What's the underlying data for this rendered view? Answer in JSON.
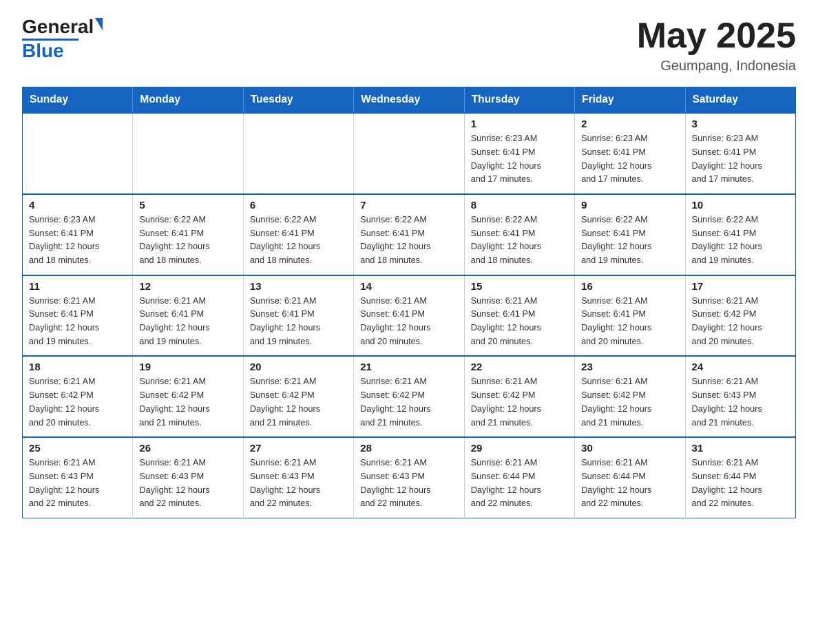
{
  "header": {
    "logo_general": "General",
    "logo_blue": "Blue",
    "title": "May 2025",
    "subtitle": "Geumpang, Indonesia"
  },
  "weekdays": [
    "Sunday",
    "Monday",
    "Tuesday",
    "Wednesday",
    "Thursday",
    "Friday",
    "Saturday"
  ],
  "weeks": [
    [
      {
        "day": "",
        "info": ""
      },
      {
        "day": "",
        "info": ""
      },
      {
        "day": "",
        "info": ""
      },
      {
        "day": "",
        "info": ""
      },
      {
        "day": "1",
        "info": "Sunrise: 6:23 AM\nSunset: 6:41 PM\nDaylight: 12 hours\nand 17 minutes."
      },
      {
        "day": "2",
        "info": "Sunrise: 6:23 AM\nSunset: 6:41 PM\nDaylight: 12 hours\nand 17 minutes."
      },
      {
        "day": "3",
        "info": "Sunrise: 6:23 AM\nSunset: 6:41 PM\nDaylight: 12 hours\nand 17 minutes."
      }
    ],
    [
      {
        "day": "4",
        "info": "Sunrise: 6:23 AM\nSunset: 6:41 PM\nDaylight: 12 hours\nand 18 minutes."
      },
      {
        "day": "5",
        "info": "Sunrise: 6:22 AM\nSunset: 6:41 PM\nDaylight: 12 hours\nand 18 minutes."
      },
      {
        "day": "6",
        "info": "Sunrise: 6:22 AM\nSunset: 6:41 PM\nDaylight: 12 hours\nand 18 minutes."
      },
      {
        "day": "7",
        "info": "Sunrise: 6:22 AM\nSunset: 6:41 PM\nDaylight: 12 hours\nand 18 minutes."
      },
      {
        "day": "8",
        "info": "Sunrise: 6:22 AM\nSunset: 6:41 PM\nDaylight: 12 hours\nand 18 minutes."
      },
      {
        "day": "9",
        "info": "Sunrise: 6:22 AM\nSunset: 6:41 PM\nDaylight: 12 hours\nand 19 minutes."
      },
      {
        "day": "10",
        "info": "Sunrise: 6:22 AM\nSunset: 6:41 PM\nDaylight: 12 hours\nand 19 minutes."
      }
    ],
    [
      {
        "day": "11",
        "info": "Sunrise: 6:21 AM\nSunset: 6:41 PM\nDaylight: 12 hours\nand 19 minutes."
      },
      {
        "day": "12",
        "info": "Sunrise: 6:21 AM\nSunset: 6:41 PM\nDaylight: 12 hours\nand 19 minutes."
      },
      {
        "day": "13",
        "info": "Sunrise: 6:21 AM\nSunset: 6:41 PM\nDaylight: 12 hours\nand 19 minutes."
      },
      {
        "day": "14",
        "info": "Sunrise: 6:21 AM\nSunset: 6:41 PM\nDaylight: 12 hours\nand 20 minutes."
      },
      {
        "day": "15",
        "info": "Sunrise: 6:21 AM\nSunset: 6:41 PM\nDaylight: 12 hours\nand 20 minutes."
      },
      {
        "day": "16",
        "info": "Sunrise: 6:21 AM\nSunset: 6:41 PM\nDaylight: 12 hours\nand 20 minutes."
      },
      {
        "day": "17",
        "info": "Sunrise: 6:21 AM\nSunset: 6:42 PM\nDaylight: 12 hours\nand 20 minutes."
      }
    ],
    [
      {
        "day": "18",
        "info": "Sunrise: 6:21 AM\nSunset: 6:42 PM\nDaylight: 12 hours\nand 20 minutes."
      },
      {
        "day": "19",
        "info": "Sunrise: 6:21 AM\nSunset: 6:42 PM\nDaylight: 12 hours\nand 21 minutes."
      },
      {
        "day": "20",
        "info": "Sunrise: 6:21 AM\nSunset: 6:42 PM\nDaylight: 12 hours\nand 21 minutes."
      },
      {
        "day": "21",
        "info": "Sunrise: 6:21 AM\nSunset: 6:42 PM\nDaylight: 12 hours\nand 21 minutes."
      },
      {
        "day": "22",
        "info": "Sunrise: 6:21 AM\nSunset: 6:42 PM\nDaylight: 12 hours\nand 21 minutes."
      },
      {
        "day": "23",
        "info": "Sunrise: 6:21 AM\nSunset: 6:42 PM\nDaylight: 12 hours\nand 21 minutes."
      },
      {
        "day": "24",
        "info": "Sunrise: 6:21 AM\nSunset: 6:43 PM\nDaylight: 12 hours\nand 21 minutes."
      }
    ],
    [
      {
        "day": "25",
        "info": "Sunrise: 6:21 AM\nSunset: 6:43 PM\nDaylight: 12 hours\nand 22 minutes."
      },
      {
        "day": "26",
        "info": "Sunrise: 6:21 AM\nSunset: 6:43 PM\nDaylight: 12 hours\nand 22 minutes."
      },
      {
        "day": "27",
        "info": "Sunrise: 6:21 AM\nSunset: 6:43 PM\nDaylight: 12 hours\nand 22 minutes."
      },
      {
        "day": "28",
        "info": "Sunrise: 6:21 AM\nSunset: 6:43 PM\nDaylight: 12 hours\nand 22 minutes."
      },
      {
        "day": "29",
        "info": "Sunrise: 6:21 AM\nSunset: 6:44 PM\nDaylight: 12 hours\nand 22 minutes."
      },
      {
        "day": "30",
        "info": "Sunrise: 6:21 AM\nSunset: 6:44 PM\nDaylight: 12 hours\nand 22 minutes."
      },
      {
        "day": "31",
        "info": "Sunrise: 6:21 AM\nSunset: 6:44 PM\nDaylight: 12 hours\nand 22 minutes."
      }
    ]
  ]
}
